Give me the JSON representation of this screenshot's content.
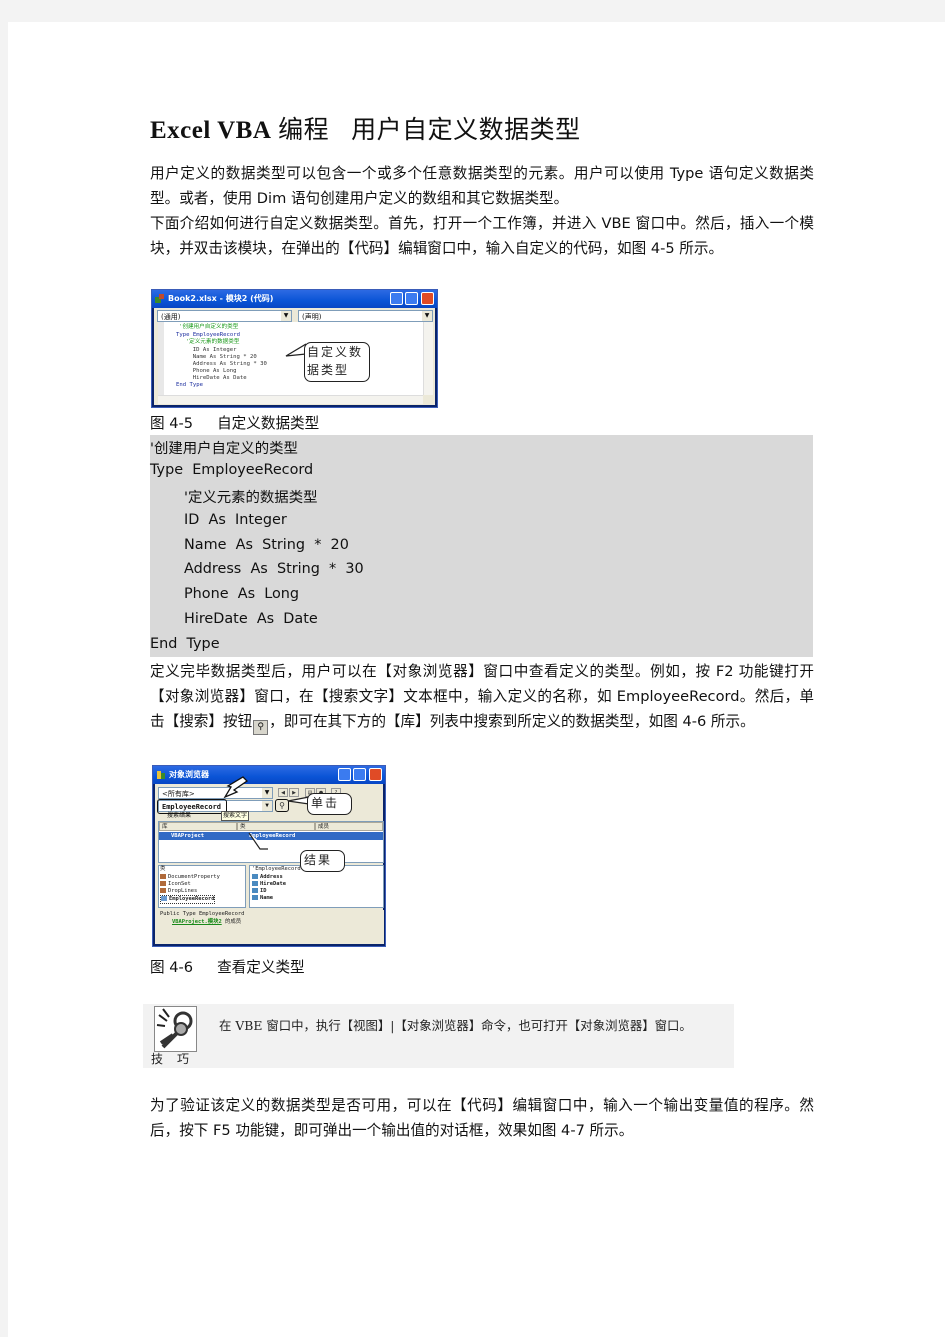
{
  "document": {
    "title_en": "Excel VBA",
    "title_zh1": "编程",
    "title_zh2": "用户自定义数据类型",
    "intro": [
      "用户定义的数据类型可以包含一个或多个任意数据类型的元素。用户可以使用 Type 语句定义数据类型。或者，使用 Dim 语句创建用户定义的数组和其它数据类型。",
      "下面介绍如何进行自定义数据类型。首先，打开一个工作簿，并进入 VBE 窗口中。然后，插入一个模块，并双击该模块，在弹出的【代码】编辑窗口中，输入自定义的代码，如图 4-5 所示。"
    ],
    "figure1": {
      "window_title": "Book2.xlsx - 模块2 (代码)",
      "combo_left": "(通用)",
      "combo_right": "(声明)",
      "code_lines": [
        "'创建用户自定义的类型",
        "Type EmployeeRecord",
        "  '定义元素的数据类型",
        "  ID As Integer",
        "  Name As String * 20",
        "  Address As String * 30",
        "  Phone As Long",
        "  HireDate As Date",
        "End Type"
      ],
      "callout": "自定义数\n据类型",
      "caption_num": "图 4-5",
      "caption_text": "自定义数据类型"
    },
    "code_block": [
      "'创建用户自定义的类型",
      "Type  EmployeeRecord",
      "'定义元素的数据类型",
      "ID  As  Integer",
      "Name  As  String  *  20",
      "Address  As  String  *  30",
      "Phone  As  Long",
      "HireDate  As  Date",
      "End  Type"
    ],
    "para2_pre": "定义完毕数据类型后，用户可以在【对象浏览器】窗口中查看定义的类型。例如，按 F2 功能键打开【对象浏览器】窗口，在【搜索文字】文本框中，输入定义的名称，如 EmployeeRecord。然后，单击【搜索】按钮",
    "para2_post": "，即可在其下方的【库】列表中搜索到所定义的数据类型，如图 4-6 所示。",
    "search_button_icon": "binoculars-icon",
    "figure2": {
      "window_title": "对象浏览器",
      "library_combo": "<所有库>",
      "search_text": "EmployeeRecord",
      "tooltip": "搜索文字",
      "results_label": "搜索结果",
      "col_library": "库",
      "col_class": "类",
      "col_member": "成员",
      "result_library": "VBAProject",
      "result_class": "EmployeeRecord",
      "callout_click": "单击",
      "callout_result": "结果",
      "classes_header": "类",
      "classes": [
        "DocumentProperty",
        "IconSet",
        "DropLines",
        "EmployeeRecord"
      ],
      "members_header": "'EmployeeRecord' 的成员",
      "members": [
        "Address",
        "HireDate",
        "ID",
        "Name"
      ],
      "details_line1": "Public Type EmployeeRecord",
      "details_link": "VBAProject.模块2",
      "details_suffix": " 的成员",
      "caption_num": "图 4-6",
      "caption_text": "查看定义类型"
    },
    "tip": {
      "text": "在 VBE 窗口中，执行【视图】|【对象浏览器】命令，也可打开【对象浏览器】窗口。",
      "label": "技巧",
      "icon": "keys-icon"
    },
    "para3": "为了验证该定义的数据类型是否可用，可以在【代码】编辑窗口中，输入一个输出变量值的程序。然后，按下 F5 功能键，即可弹出一个输出值的对话框，效果如图 4-7 所示。"
  }
}
